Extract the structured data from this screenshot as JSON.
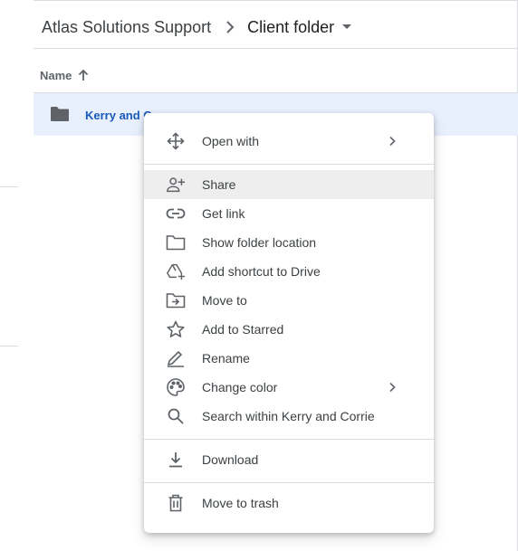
{
  "breadcrumb": {
    "root": "Atlas Solutions Support",
    "current": "Client folder"
  },
  "list": {
    "column_name": "Name",
    "sort": "ascending",
    "rows": [
      {
        "name": "Kerry and C...",
        "selected": true,
        "icon": "folder-icon"
      }
    ]
  },
  "context_menu": {
    "hovered_item": "Share",
    "groups": [
      [
        {
          "label": "Open with",
          "icon": "open-with-icon",
          "submenu": true
        }
      ],
      [
        {
          "label": "Share",
          "icon": "add-person-icon"
        },
        {
          "label": "Get link",
          "icon": "link-icon"
        },
        {
          "label": "Show folder location",
          "icon": "folder-outline-icon"
        },
        {
          "label": "Add shortcut to Drive",
          "icon": "drive-shortcut-icon"
        },
        {
          "label": "Move to",
          "icon": "move-to-folder-icon"
        },
        {
          "label": "Add to Starred",
          "icon": "star-outline-icon"
        },
        {
          "label": "Rename",
          "icon": "pencil-icon"
        },
        {
          "label": "Change color",
          "icon": "palette-icon",
          "submenu": true
        },
        {
          "label": "Search within Kerry and Corrie",
          "icon": "search-icon"
        }
      ],
      [
        {
          "label": "Download",
          "icon": "download-icon"
        }
      ],
      [
        {
          "label": "Move to trash",
          "icon": "trash-icon"
        }
      ]
    ]
  },
  "colors": {
    "selected_row": "#e8f0fe",
    "link_blue": "#185abc",
    "hover_gray": "#eeeeee",
    "icon_gray": "#5f6368"
  }
}
